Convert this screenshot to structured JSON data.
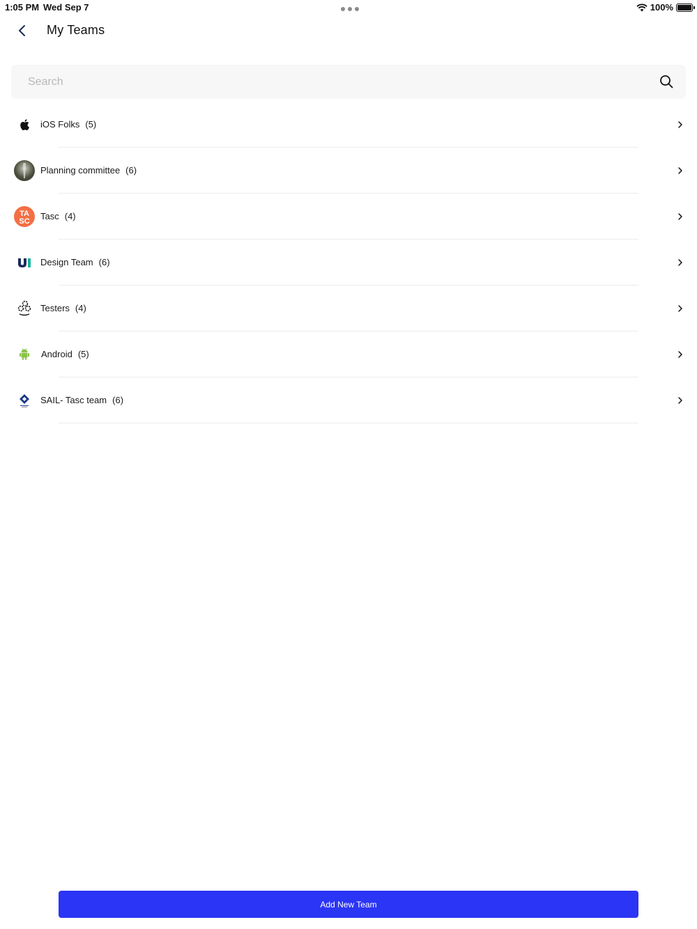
{
  "status_bar": {
    "time": "1:05 PM",
    "date": "Wed Sep 7",
    "battery": "100%",
    "icons": [
      "wifi-icon",
      "battery-icon"
    ]
  },
  "header": {
    "title": "My Teams",
    "back_icon": "chevron-left-icon"
  },
  "search": {
    "placeholder": "Search",
    "value": "",
    "icon": "search-icon"
  },
  "teams": [
    {
      "name": "iOS Folks",
      "count": "(5)",
      "icon": "apple-icon"
    },
    {
      "name": "Planning committee",
      "count": "(6)",
      "icon": "photo-avatar"
    },
    {
      "name": "Tasc",
      "count": "(4)",
      "icon": "tasc-logo"
    },
    {
      "name": "Design Team",
      "count": "(6)",
      "icon": "ui-logo"
    },
    {
      "name": "Testers",
      "count": "(4)",
      "icon": "gears-icon"
    },
    {
      "name": "Android",
      "count": "(5)",
      "icon": "android-icon"
    },
    {
      "name": "SAIL- Tasc team",
      "count": "(6)",
      "icon": "sail-logo"
    }
  ],
  "footer": {
    "add_button_label": "Add New Team"
  },
  "colors": {
    "accent": "#2b35f5",
    "divider": "#ececec",
    "search_bg": "#f7f7f7",
    "tasc_orange": "#f36f45",
    "android_green": "#8bc34a",
    "ui_navy": "#1b2a5c",
    "ui_teal": "#18b39a"
  }
}
